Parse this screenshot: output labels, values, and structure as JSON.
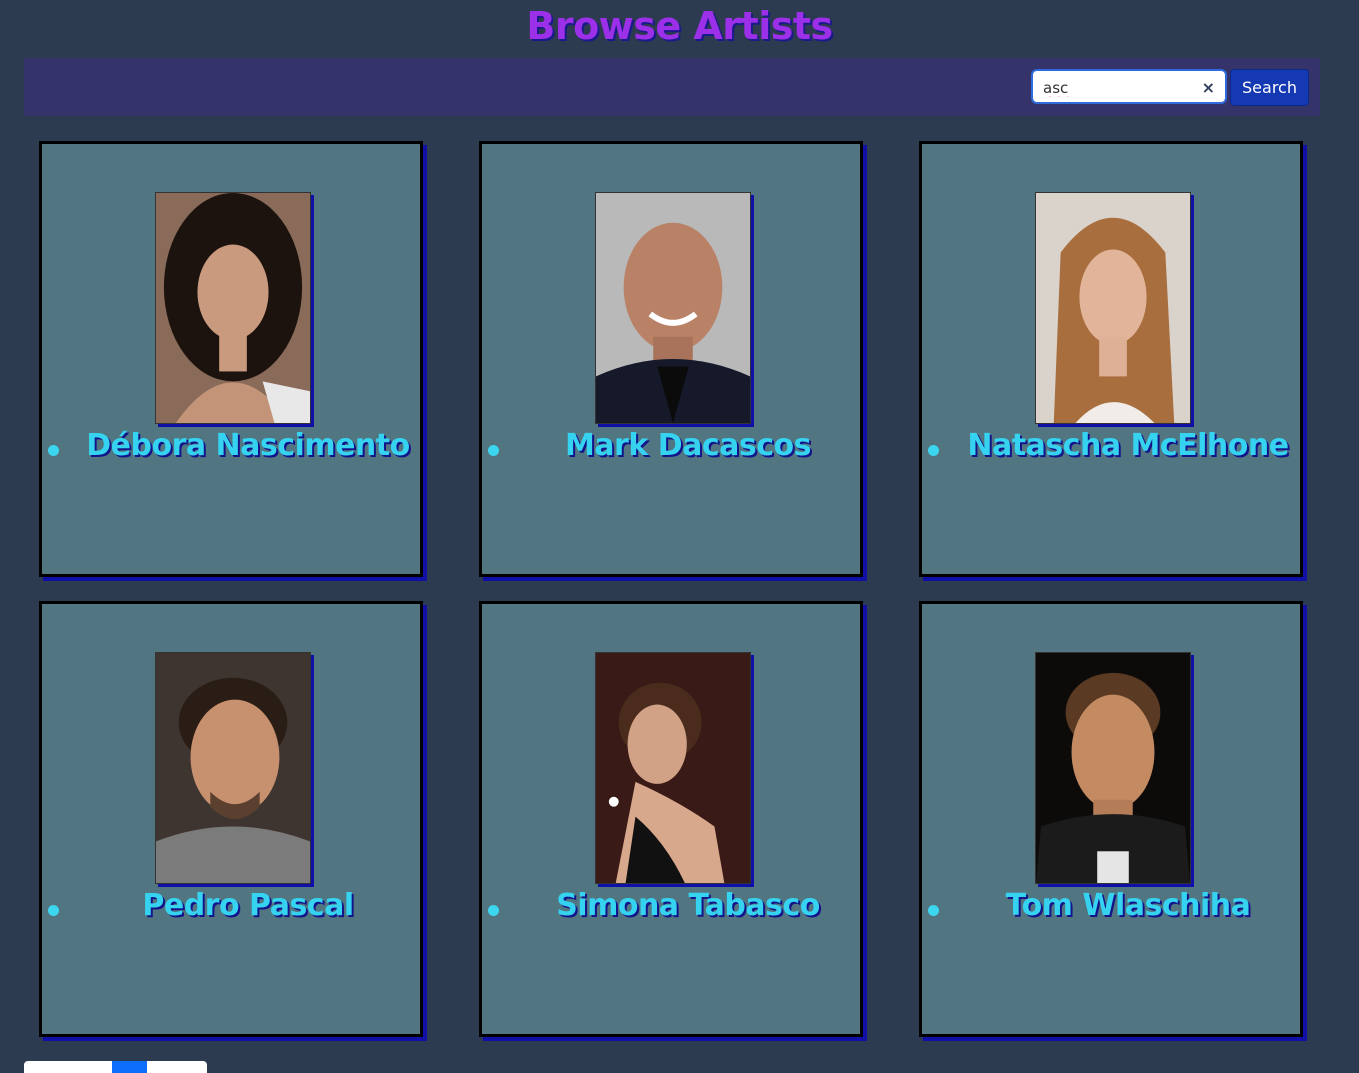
{
  "page": {
    "title": "Browse Artists"
  },
  "search": {
    "value": "asc",
    "button_label": "Search",
    "clear_symbol": "×"
  },
  "artists": [
    {
      "name": "Débora Nascimento"
    },
    {
      "name": "Mark Dacascos"
    },
    {
      "name": "Natascha McElhone"
    },
    {
      "name": "Pedro Pascal"
    },
    {
      "name": "Simona Tabasco"
    },
    {
      "name": "Tom Wlaschiha"
    }
  ],
  "colors": {
    "background": "#2c3b4f",
    "card": "#527582",
    "title": "#9b30e8",
    "name": "#35d3ef",
    "accent": "#1538b3"
  }
}
